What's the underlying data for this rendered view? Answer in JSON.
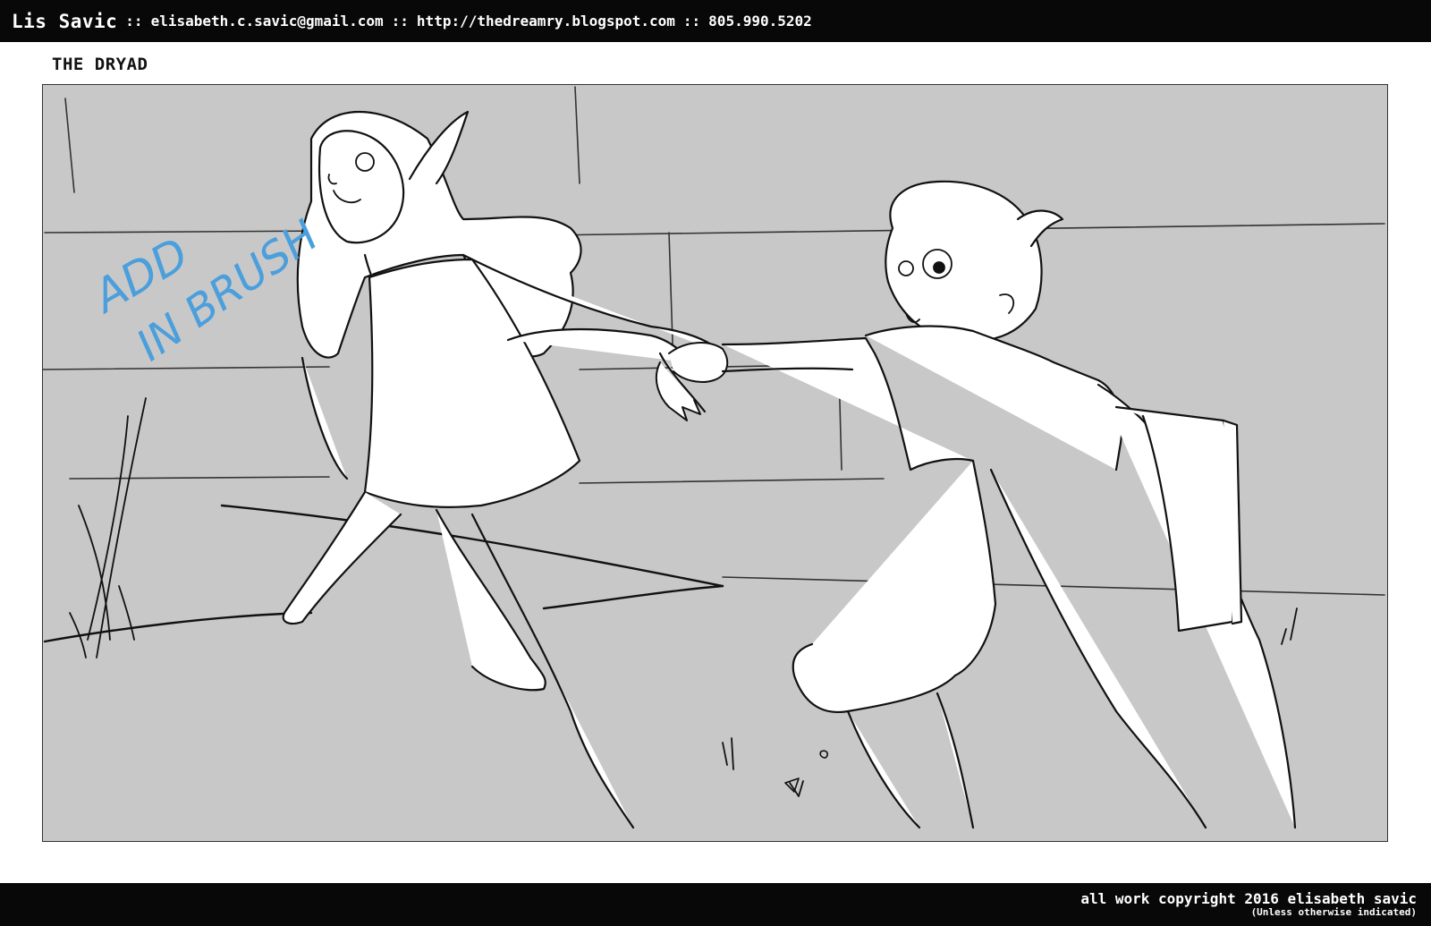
{
  "header": {
    "name": "Lis Savic",
    "separator": "::",
    "email": "elisabeth.c.savic@gmail.com",
    "website": "http://thedreamry.blogspot.com",
    "phone": "805.990.5202"
  },
  "panel": {
    "title": "THE DRYAD",
    "note_line1": "ADD",
    "note_line2": "IN BRUSH",
    "note_color": "#4a9fdc",
    "background_color": "#c8c8c8"
  },
  "footer": {
    "copyright": "all work copyright 2016 elisabeth savic",
    "note": "(Unless otherwise indicated)"
  }
}
